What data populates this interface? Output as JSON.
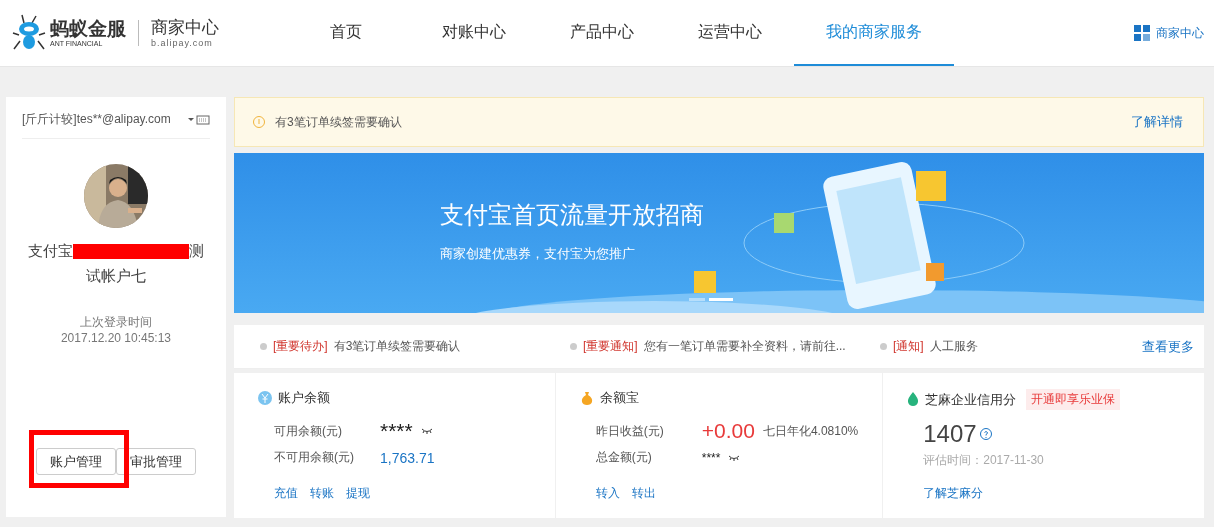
{
  "header": {
    "logo": {
      "brand_cn": "蚂蚁金服",
      "brand_en": "ANT FINANCIAL",
      "product": "商家中心",
      "domain": "b.alipay.com"
    },
    "nav": [
      {
        "label": "首页",
        "selected": false
      },
      {
        "label": "对账中心",
        "selected": false
      },
      {
        "label": "产品中心",
        "selected": false
      },
      {
        "label": "运营中心",
        "selected": false
      },
      {
        "label": "我的商家服务",
        "selected": true
      }
    ],
    "merchant_link": "商家中心"
  },
  "account": {
    "login": "[斤斤计较]tes**@alipay.com",
    "name_start": "支付宝",
    "name_end": "测",
    "name_line2": "试帐户七",
    "last_login_label": "上次登录时间",
    "last_login_time": "2017.12.20 10:45:13",
    "buttons": [
      {
        "label": "账户管理",
        "highlighted": true
      },
      {
        "label": "审批管理",
        "highlighted": false
      }
    ]
  },
  "notice": {
    "text": "有3笔订单续签需要确认",
    "link": "了解详情"
  },
  "banner": {
    "title": "支付宝首页流量开放招商",
    "subtitle": "商家创建优惠券，支付宝为您推广",
    "slides": [
      {
        "selected": false
      },
      {
        "selected": true
      }
    ]
  },
  "bulletins": {
    "items": [
      {
        "tag": "[重要待办]",
        "text": "有3笔订单续签需要确认"
      },
      {
        "tag": "[重要通知]",
        "text": "您有一笔订单需要补全资料，请前往..."
      },
      {
        "tag": "[通知]",
        "text": "人工服务"
      }
    ],
    "more": "查看更多"
  },
  "cards": [
    {
      "kind": "balance",
      "title": "账户余额",
      "rows": [
        {
          "label": "可用余额(元)",
          "value": "****",
          "kind": "masked-large"
        },
        {
          "label": "不可用余额(元)",
          "value": "1,763.71",
          "kind": "amount"
        }
      ],
      "links": [
        "充值",
        "转账",
        "提现"
      ]
    },
    {
      "kind": "yuebao",
      "title": "余额宝",
      "rows": [
        {
          "label": "昨日收益(元)",
          "value": "+0.00",
          "kind": "gain",
          "note": "七日年化4.0810%"
        },
        {
          "label": "总金额(元)",
          "value": "****",
          "kind": "masked"
        }
      ],
      "links": [
        "转入",
        "转出"
      ]
    },
    {
      "kind": "credit",
      "title": "芝麻企业信用分",
      "badge": "开通即享乐业保",
      "score": "1407",
      "evaluated": "评估时间：2017-11-30",
      "links": [
        "了解芝麻分"
      ]
    }
  ]
}
